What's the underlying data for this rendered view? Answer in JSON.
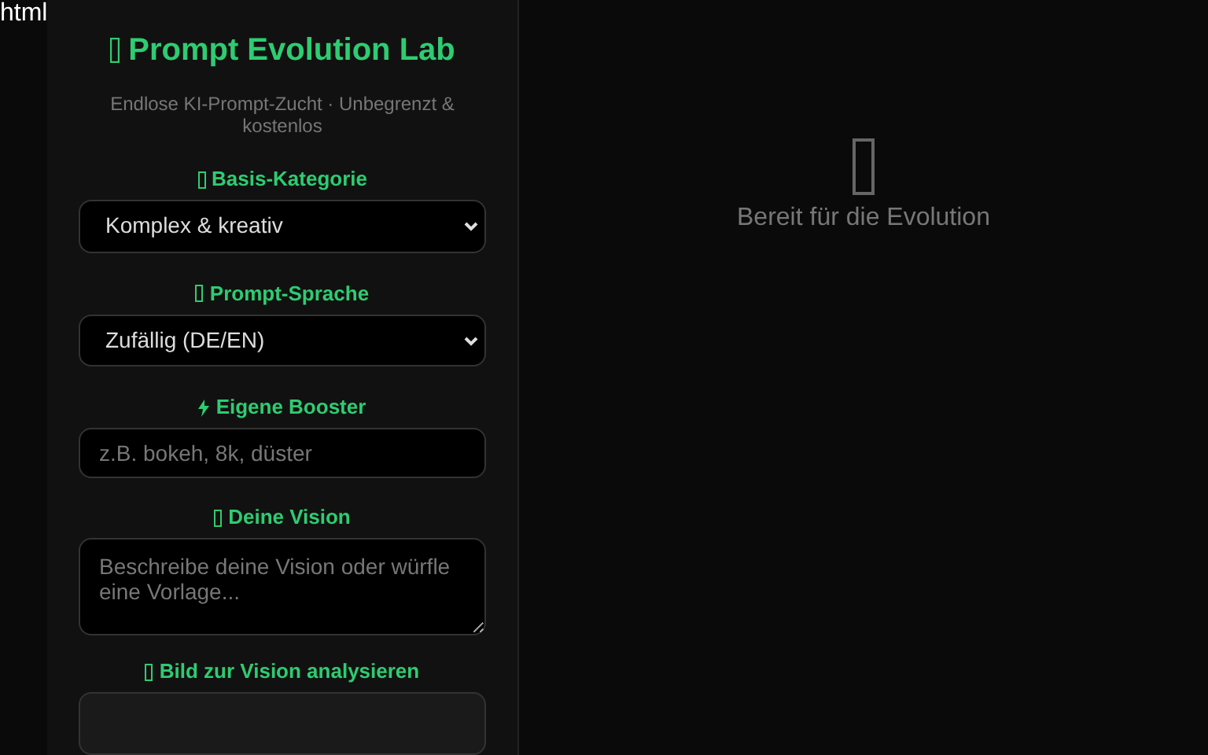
{
  "page_label": "html",
  "sidebar": {
    "title": "Prompt Evolution Lab",
    "subtitle": "Endlose KI-Prompt-Zucht · Unbegrenzt & kostenlos",
    "fields": [
      {
        "kind": "select",
        "label": "Basis-Kategorie",
        "value": "Komplex & kreativ"
      },
      {
        "kind": "select",
        "label": "Prompt-Sprache",
        "value": "Zufällig (DE/EN)"
      },
      {
        "kind": "input",
        "label": "Eigene Booster",
        "placeholder": "z.B. bokeh, 8k, düster"
      },
      {
        "kind": "textarea",
        "label": "Deine Vision",
        "placeholder": "Beschreibe deine Vision oder würfle eine Vorlage..."
      },
      {
        "kind": "upload",
        "label": "Bild zur Vision analysieren"
      }
    ]
  },
  "main": {
    "empty_text": "Bereit für die Evolution"
  }
}
